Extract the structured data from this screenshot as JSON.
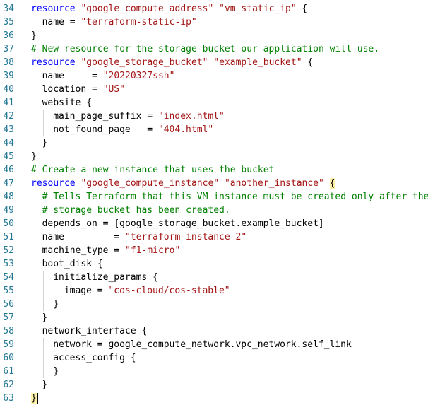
{
  "editor": {
    "lines": [
      {
        "num": "34",
        "indent": 0,
        "tokens": [
          {
            "c": "kw",
            "t": "resource"
          },
          {
            "c": "",
            "t": " "
          },
          {
            "c": "str",
            "t": "\"google_compute_address\""
          },
          {
            "c": "",
            "t": " "
          },
          {
            "c": "str",
            "t": "\"vm_static_ip\""
          },
          {
            "c": "",
            "t": " {"
          }
        ]
      },
      {
        "num": "35",
        "indent": 1,
        "tokens": [
          {
            "c": "",
            "t": "name = "
          },
          {
            "c": "str",
            "t": "\"terraform-static-ip\""
          }
        ]
      },
      {
        "num": "36",
        "indent": 0,
        "tokens": [
          {
            "c": "",
            "t": "}"
          }
        ]
      },
      {
        "num": "37",
        "indent": 0,
        "tokens": [
          {
            "c": "cm",
            "t": "# New resource for the storage bucket our application will use."
          }
        ]
      },
      {
        "num": "38",
        "indent": 0,
        "tokens": [
          {
            "c": "kw",
            "t": "resource"
          },
          {
            "c": "",
            "t": " "
          },
          {
            "c": "str",
            "t": "\"google_storage_bucket\""
          },
          {
            "c": "",
            "t": " "
          },
          {
            "c": "str",
            "t": "\"example_bucket\""
          },
          {
            "c": "",
            "t": " {"
          }
        ]
      },
      {
        "num": "39",
        "indent": 1,
        "tokens": [
          {
            "c": "",
            "t": "name     = "
          },
          {
            "c": "str",
            "t": "\"20220327ssh\""
          }
        ]
      },
      {
        "num": "40",
        "indent": 1,
        "tokens": [
          {
            "c": "",
            "t": "location = "
          },
          {
            "c": "str",
            "t": "\"US\""
          }
        ]
      },
      {
        "num": "41",
        "indent": 1,
        "tokens": [
          {
            "c": "",
            "t": "website {"
          }
        ]
      },
      {
        "num": "42",
        "indent": 2,
        "tokens": [
          {
            "c": "",
            "t": "main_page_suffix = "
          },
          {
            "c": "str",
            "t": "\"index.html\""
          }
        ]
      },
      {
        "num": "43",
        "indent": 2,
        "tokens": [
          {
            "c": "",
            "t": "not_found_page   = "
          },
          {
            "c": "str",
            "t": "\"404.html\""
          }
        ]
      },
      {
        "num": "44",
        "indent": 1,
        "tokens": [
          {
            "c": "",
            "t": "}"
          }
        ]
      },
      {
        "num": "45",
        "indent": 0,
        "tokens": [
          {
            "c": "",
            "t": "}"
          }
        ]
      },
      {
        "num": "46",
        "indent": 0,
        "tokens": [
          {
            "c": "cm",
            "t": "# Create a new instance that uses the bucket"
          }
        ]
      },
      {
        "num": "47",
        "indent": 0,
        "tokens": [
          {
            "c": "kw",
            "t": "resource"
          },
          {
            "c": "",
            "t": " "
          },
          {
            "c": "str",
            "t": "\"google_compute_instance\""
          },
          {
            "c": "",
            "t": " "
          },
          {
            "c": "str",
            "t": "\"another_instance\""
          },
          {
            "c": "",
            "t": " "
          },
          {
            "c": "hl",
            "t": "{"
          }
        ]
      },
      {
        "num": "48",
        "indent": 1,
        "tokens": [
          {
            "c": "cm",
            "t": "# Tells Terraform that this VM instance must be created only after the"
          }
        ]
      },
      {
        "num": "49",
        "indent": 1,
        "tokens": [
          {
            "c": "cm",
            "t": "# storage bucket has been created."
          }
        ]
      },
      {
        "num": "50",
        "indent": 1,
        "tokens": [
          {
            "c": "",
            "t": "depends_on = [google_storage_bucket.example_bucket]"
          }
        ]
      },
      {
        "num": "51",
        "indent": 1,
        "tokens": [
          {
            "c": "",
            "t": "name         = "
          },
          {
            "c": "str",
            "t": "\"terraform-instance-2\""
          }
        ]
      },
      {
        "num": "52",
        "indent": 1,
        "tokens": [
          {
            "c": "",
            "t": "machine_type = "
          },
          {
            "c": "str",
            "t": "\"f1-micro\""
          }
        ]
      },
      {
        "num": "53",
        "indent": 1,
        "tokens": [
          {
            "c": "",
            "t": "boot_disk {"
          }
        ]
      },
      {
        "num": "54",
        "indent": 2,
        "tokens": [
          {
            "c": "",
            "t": "initialize_params {"
          }
        ]
      },
      {
        "num": "55",
        "indent": 3,
        "tokens": [
          {
            "c": "",
            "t": "image = "
          },
          {
            "c": "str",
            "t": "\"cos-cloud/cos-stable\""
          }
        ]
      },
      {
        "num": "56",
        "indent": 2,
        "tokens": [
          {
            "c": "",
            "t": "}"
          }
        ]
      },
      {
        "num": "57",
        "indent": 1,
        "tokens": [
          {
            "c": "",
            "t": "}"
          }
        ]
      },
      {
        "num": "58",
        "indent": 1,
        "tokens": [
          {
            "c": "",
            "t": "network_interface {"
          }
        ]
      },
      {
        "num": "59",
        "indent": 2,
        "tokens": [
          {
            "c": "",
            "t": "network = google_compute_network.vpc_network.self_link"
          }
        ]
      },
      {
        "num": "60",
        "indent": 2,
        "tokens": [
          {
            "c": "",
            "t": "access_config {"
          }
        ]
      },
      {
        "num": "61",
        "indent": 2,
        "tokens": [
          {
            "c": "",
            "t": "}"
          }
        ]
      },
      {
        "num": "62",
        "indent": 1,
        "tokens": [
          {
            "c": "",
            "t": "}"
          }
        ]
      },
      {
        "num": "63",
        "indent": 0,
        "tokens": [
          {
            "c": "hl",
            "t": "}"
          }
        ],
        "cursor": true
      }
    ]
  }
}
